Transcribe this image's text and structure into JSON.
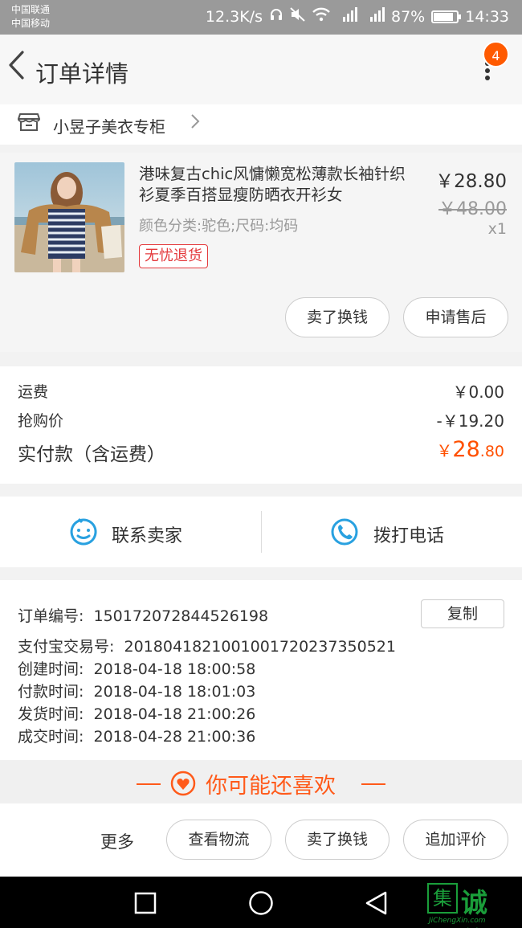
{
  "status_bar": {
    "carrier1": "中国联通",
    "carrier2": "中国移动",
    "speed": "12.3K/s",
    "battery": "87%",
    "time": "14:33"
  },
  "nav": {
    "title": "订单详情",
    "badge": "4"
  },
  "shop": {
    "name": "小昱子美衣专柜"
  },
  "product": {
    "title": "港味复古chic风慵懒宽松薄款长袖针织衫夏季百搭显瘦防晒衣开衫女",
    "variant": "颜色分类:驼色;尺码:均码",
    "tag": "无忧退货",
    "price": "￥28.80",
    "original_price": "￥48.00",
    "quantity": "x1",
    "buttons": [
      "卖了换钱",
      "申请售后"
    ]
  },
  "fees": {
    "shipping_label": "运费",
    "shipping_value": "￥0.00",
    "flash_label": "抢购价",
    "flash_value": "-￥19.20",
    "paid_label": "实付款（含运费）",
    "paid_currency": "￥",
    "paid_int": "28",
    "paid_dec": ".80"
  },
  "contact": {
    "seller_label": "联系卖家",
    "phone_label": "拨打电话"
  },
  "order_info": {
    "order_no_label": "订单编号:",
    "order_no": "150172072844526198",
    "copy_label": "复制",
    "alipay_label": "支付宝交易号:",
    "alipay_no": "2018041821001001720237350521",
    "created_label": "创建时间:",
    "created": "2018-04-18 18:00:58",
    "paid_label": "付款时间:",
    "paid": "2018-04-18 18:01:03",
    "shipped_label": "发货时间:",
    "shipped": "2018-04-18 21:00:26",
    "completed_label": "成交时间:",
    "completed": "2018-04-28 21:00:36"
  },
  "recommend": {
    "title": "你可能还喜欢"
  },
  "actions": {
    "more": "更多",
    "logistics": "查看物流",
    "sell": "卖了换钱",
    "review": "追加评价"
  },
  "watermark": {
    "box_char": "集",
    "text": "诚信",
    "sub": "JiChengXin.com"
  },
  "colors": {
    "accent": "#ff5000",
    "tag_red": "#e4393c",
    "blue_icon": "#29a1e0"
  }
}
